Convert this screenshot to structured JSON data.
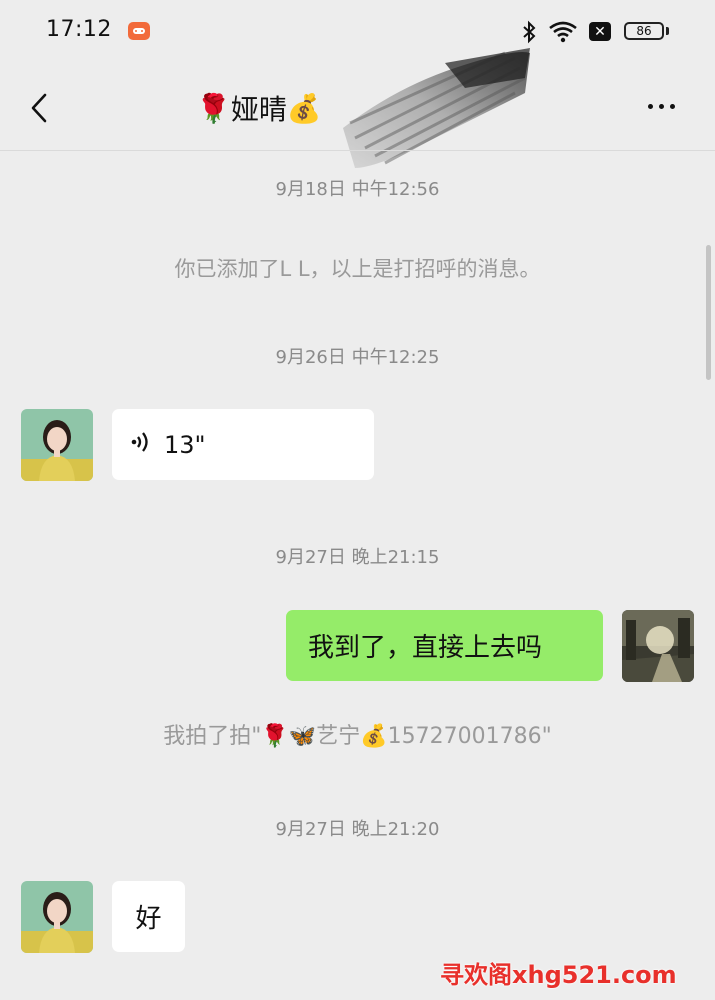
{
  "status_bar": {
    "time": "17:12",
    "battery": "86",
    "icons": [
      "game-app-icon",
      "bluetooth-icon",
      "wifi-icon",
      "close-box-icon"
    ]
  },
  "nav": {
    "title_prefix_emoji": "🌹",
    "title": "娅晴",
    "title_suffix_emoji": "💰",
    "back_icon": "chevron-left-icon",
    "more_icon": "more-icon"
  },
  "messages": {
    "ts1": "9月18日 中午12:56",
    "system_added": "你已添加了L L，以上是打招呼的消息。",
    "ts2": "9月26日 中午12:25",
    "voice_duration": "13\"",
    "ts3": "9月27日 晚上21:15",
    "outgoing_text": "我到了，直接上去吗",
    "pat_prefix": "我拍了拍\"",
    "pat_emoji1": "🌹",
    "pat_emoji2": "🦋",
    "pat_name": "艺宁",
    "pat_emoji3": "💰",
    "pat_suffix": "15727001786\"",
    "ts4": "9月27日 晚上21:20",
    "reply_text": "好"
  },
  "watermark": "寻欢阁xhg521.com",
  "colors": {
    "background": "#ededed",
    "outgoing_bubble": "#95ec69",
    "incoming_bubble": "#ffffff",
    "watermark": "#e8302b"
  }
}
